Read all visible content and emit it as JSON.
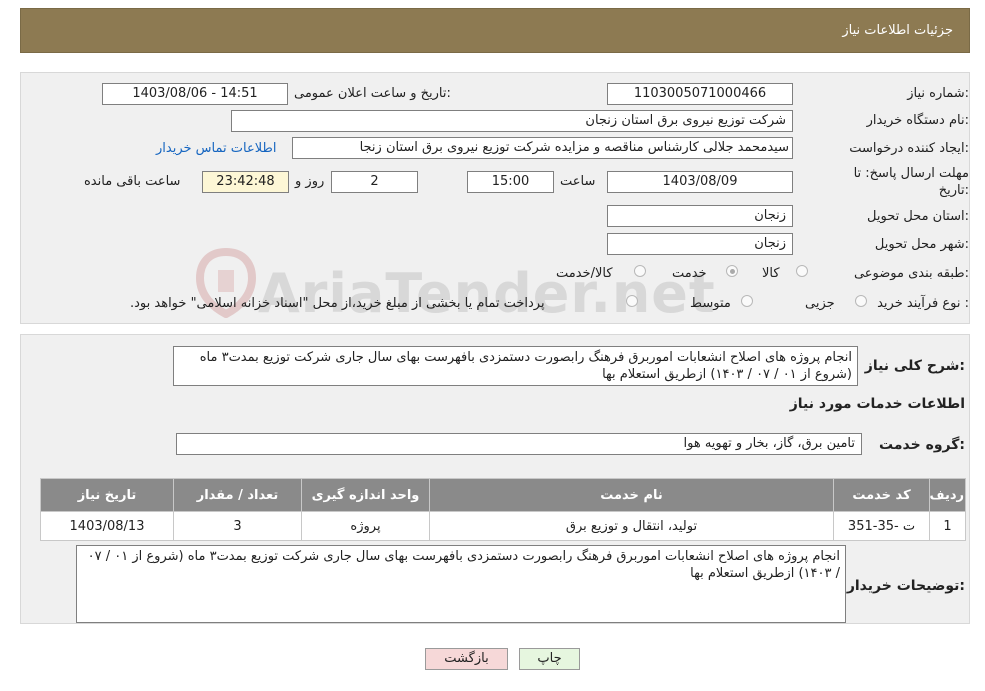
{
  "header": {
    "title": "جزئیات اطلاعات نیاز"
  },
  "form": {
    "need_number_label": "شماره نیاز:",
    "need_number": "1103005071000466",
    "announce_label": "تاریخ و ساعت اعلان عمومی:",
    "announce_value": "1403/08/06 - 14:51",
    "buyer_org_label": "نام دستگاه خریدار:",
    "buyer_org": "شرکت توزیع نیروی برق استان زنجان",
    "requester_label": "ایجاد کننده درخواست:",
    "requester": "سیدمحمد جلالی کارشناس مناقصه و مزایده شرکت توزیع نیروی برق استان زنجا",
    "contact_link": "اطلاعات تماس خریدار",
    "deadline_label_1": "مهلت ارسال پاسخ: تا",
    "deadline_label_2": "تاریخ:",
    "deadline_date": "1403/08/09",
    "time_label": "ساعت",
    "deadline_time": "15:00",
    "days_value": "2",
    "days_label": "روز و",
    "remaining_value": "23:42:48",
    "remaining_label": "ساعت باقی مانده",
    "province_label": "استان محل تحویل:",
    "province": "زنجان",
    "city_label": "شهر محل تحویل:",
    "city": "زنجان",
    "category_label": "طبقه بندی موضوعی:",
    "category_options": [
      "کالا",
      "خدمت",
      "کالا/خدمت"
    ],
    "category_selected": "خدمت",
    "purchase_label": "نوع فرآیند خرید :",
    "purchase_options": [
      "جزیی",
      "متوسط"
    ],
    "purchase_note": "پرداخت تمام یا بخشی از مبلغ خرید،از محل \"اسناد خزانه اسلامی\" خواهد بود."
  },
  "summary": {
    "label": "شرح کلی نیاز:",
    "text": "انجام پروژه های اصلاح انشعابات اموربرق فرهنگ رابصورت دستمزدی بافهرست بهای سال جاری شرکت توزیع بمدت۳ ماه (شروع از ۰۱ / ۰۷ / ۱۴۰۳) ازطریق استعلام بها"
  },
  "services": {
    "section_title": "اطلاعات خدمات مورد نیاز",
    "group_label": "گروه خدمت:",
    "group_value": "تامین برق، گاز، بخار و تهویه هوا",
    "columns": [
      "ردیف",
      "کد خدمت",
      "نام خدمت",
      "واحد اندازه گیری",
      "تعداد / مقدار",
      "تاریخ نیاز"
    ],
    "rows": [
      [
        "1",
        "ت -35-351",
        "تولید، انتقال و توزیع برق",
        "پروژه",
        "3",
        "1403/08/13"
      ]
    ]
  },
  "buyer_notes": {
    "label": "توضیحات خریدار:",
    "text": "انجام پروژه های اصلاح انشعابات اموربرق فرهنگ رابصورت دستمزدی بافهرست بهای سال جاری شرکت توزیع بمدت۳ ماه (شروع از ۰۱ / ۰۷ / ۱۴۰۳) ازطریق استعلام بها"
  },
  "buttons": {
    "print": "چاپ",
    "back": "بازگشت"
  },
  "watermark": {
    "text": "AriaTender.net"
  },
  "colors": {
    "header": "#8d7a52",
    "link": "#1565c0",
    "back_button": "#f6d8d8",
    "print_button": "#e6f6df"
  }
}
